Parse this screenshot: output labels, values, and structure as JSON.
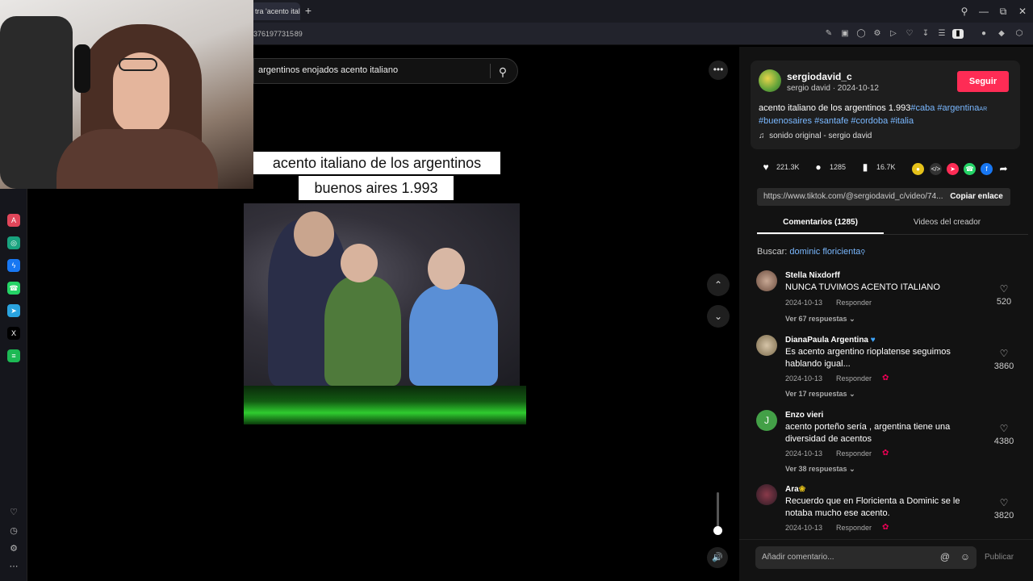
{
  "browser": {
    "tab_title": "tra 'acento ital",
    "new_tab_icon": "plus-icon",
    "url": "3761977315 89",
    "window_controls": [
      "search-icon",
      "minimize-icon",
      "restore-icon",
      "close-icon"
    ]
  },
  "sidebar": {
    "apps": [
      {
        "name": "aria",
        "glyph": "A",
        "color": "#e0465a"
      },
      {
        "name": "chatgpt",
        "glyph": "◎",
        "color": "#19a37f"
      },
      {
        "name": "messenger",
        "glyph": "ϟ",
        "color": "#1877f2"
      },
      {
        "name": "whatsapp",
        "glyph": "☎",
        "color": "#25d366"
      },
      {
        "name": "telegram",
        "glyph": "➤",
        "color": "#2aa3df"
      },
      {
        "name": "x",
        "glyph": "X",
        "color": "#000000"
      },
      {
        "name": "spotify",
        "glyph": "≡",
        "color": "#1db954"
      }
    ]
  },
  "search": {
    "query": "argentinos enojados acento italiano"
  },
  "video": {
    "caption_line1": "acento italiano de los argentinos",
    "caption_line2": "buenos aires 1.993"
  },
  "creator": {
    "username": "sergiodavid_c",
    "subline": "sergio david · 2024-10-12",
    "follow_label": "Seguir",
    "description": "acento italiano de los argentinos 1.993",
    "tags_line1": [
      "#caba",
      "#argentina"
    ],
    "flag_text": "AR",
    "tags_line2": [
      "#buenosaires",
      "#santafe",
      "#cordoba",
      "#italia"
    ],
    "sound": "sonido original - sergio david"
  },
  "stats": {
    "likes": "221.3K",
    "comments": "1285",
    "saves": "16.7K"
  },
  "share": {
    "link": "https://www.tiktok.com/@sergiodavid_c/video/74...",
    "copy_label": "Copiar enlace"
  },
  "tabs": {
    "comments": "Comentarios (1285)",
    "videos": "Videos del creador"
  },
  "buscar": {
    "label": "Buscar:",
    "term": "dominic floricienta"
  },
  "comments": [
    {
      "name": "Stella Nixdorff",
      "text": "NUNCA TUVIMOS ACENTO ITALIANO",
      "date": "2024-10-13",
      "reply": "Responder",
      "more": "Ver 67 respuestas",
      "likes": "520"
    },
    {
      "name": "DianaPaula Argentina",
      "text": "Es acento argentino rioplatense seguimos hablando igual...",
      "date": "2024-10-13",
      "reply": "Responder",
      "more": "Ver 17 respuestas",
      "likes": "3860"
    },
    {
      "name": "Enzo vieri",
      "avatar_letter": "J",
      "text": "acento porteño sería , argentina tiene una diversidad de acentos",
      "date": "2024-10-13",
      "reply": "Responder",
      "more": "Ver 38 respuestas",
      "likes": "4380"
    },
    {
      "name": "Ara",
      "text": "Recuerdo que en Floricienta a Dominic se le notaba mucho ese acento.",
      "date": "2024-10-13",
      "reply": "Responder",
      "likes": "3820"
    }
  ],
  "composer": {
    "placeholder": "Añadir comentario...",
    "publish": "Publicar"
  },
  "colors": {
    "accent": "#fe2c55",
    "link": "#7ab8ff"
  }
}
